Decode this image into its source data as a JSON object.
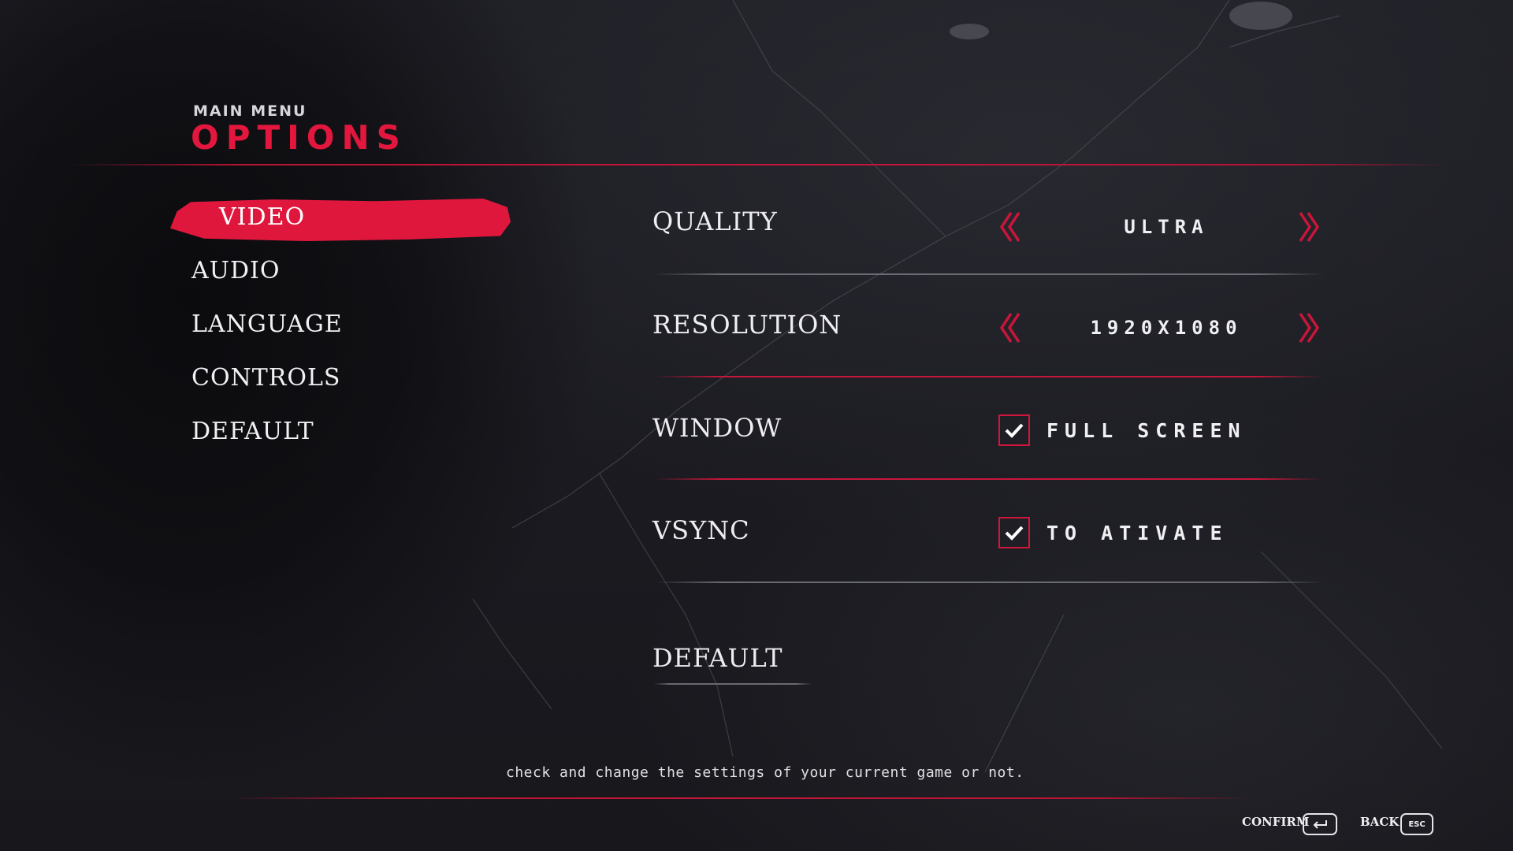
{
  "header": {
    "subtitle": "MAIN MENU",
    "title": "OPTIONS"
  },
  "sidebar": {
    "items": [
      {
        "label": "VIDEO",
        "active": true
      },
      {
        "label": "AUDIO",
        "active": false
      },
      {
        "label": "LANGUAGE",
        "active": false
      },
      {
        "label": "CONTROLS",
        "active": false
      },
      {
        "label": "DEFAULT",
        "active": false
      }
    ]
  },
  "settings": {
    "quality": {
      "label": "QUALITY",
      "value": "ULTRA"
    },
    "resolution": {
      "label": "RESOLUTION",
      "value": "1920X1080"
    },
    "window": {
      "label": "WINDOW",
      "option": "FULL SCREEN",
      "checked": true
    },
    "vsync": {
      "label": "VSYNC",
      "option": "TO ATIVATE",
      "checked": true
    },
    "default": {
      "label": "DEFAULT"
    }
  },
  "footer": {
    "description": "check and change the settings of your current game or not.",
    "confirm_label": "CONFIRM",
    "back_label": "BACK",
    "back_key": "ESC"
  },
  "icons": {
    "arrow_left": "double-chevron-left-icon",
    "arrow_right": "double-chevron-right-icon",
    "checkbox": "check-icon",
    "confirm_key": "enter-key-icon"
  },
  "colors": {
    "accent": "#e3173e",
    "background": "#1b1b21",
    "text": "#ecebee"
  }
}
